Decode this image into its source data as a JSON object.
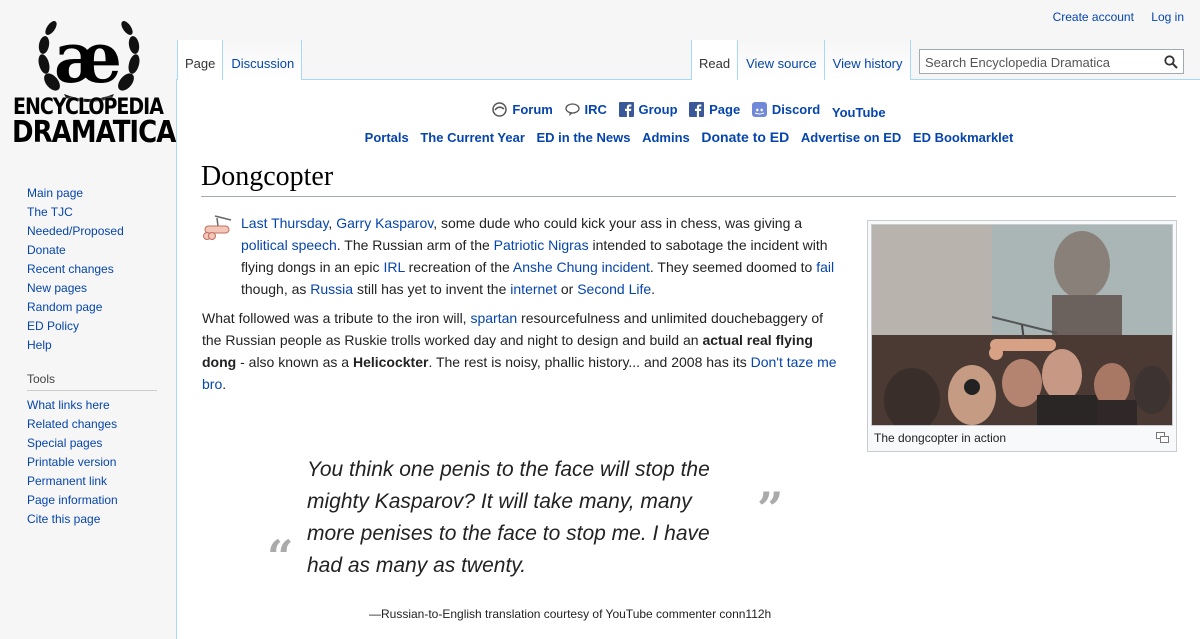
{
  "logo": {
    "mark": "æ",
    "line1": "ENCYCLOPEDIA",
    "line2": "DRAMATICA"
  },
  "personal": {
    "create_account": "Create account",
    "log_in": "Log in"
  },
  "tabs": {
    "left": [
      {
        "label": "Page",
        "selected": true
      },
      {
        "label": "Discussion",
        "selected": false
      }
    ],
    "right": [
      {
        "label": "Read",
        "selected": true
      },
      {
        "label": "View source",
        "selected": false
      },
      {
        "label": "View history",
        "selected": false
      }
    ]
  },
  "search": {
    "placeholder": "Search Encyclopedia Dramatica",
    "icon": "search-icon"
  },
  "sidebar": {
    "nav": [
      "Main page",
      "The TJC",
      "Needed/Proposed",
      "Donate",
      "Recent changes",
      "New pages",
      "Random page",
      "ED Policy",
      "Help"
    ],
    "tools_heading": "Tools",
    "tools": [
      "What links here",
      "Related changes",
      "Special pages",
      "Printable version",
      "Permanent link",
      "Page information",
      "Cite this page"
    ]
  },
  "topnav": {
    "row1": [
      {
        "label": "Forum",
        "icon": "forum-icon"
      },
      {
        "label": "IRC",
        "icon": "irc-icon"
      },
      {
        "label": "Group",
        "icon": "facebook-icon"
      },
      {
        "label": "Page",
        "icon": "facebook-icon"
      },
      {
        "label": "Discord",
        "icon": "discord-icon"
      },
      {
        "label": "YouTube",
        "icon": ""
      }
    ],
    "row2": [
      "Portals",
      "The Current Year",
      "ED in the News",
      "Admins",
      "Donate to ED",
      "Advertise on ED",
      "ED Bookmarklet"
    ]
  },
  "article": {
    "title": "Dongcopter",
    "p1": {
      "link1": "Last Thursday",
      "t1": ", ",
      "link2": "Garry Kasparov",
      "t2": ", some dude who could kick your ass in chess, was giving a ",
      "link3": "political speech",
      "t3": ". The Russian arm of the ",
      "link4": "Patriotic Nigras",
      "t4": " intended to sabotage the incident with flying dongs in an epic ",
      "link5": "IRL",
      "t5": " recreation of the ",
      "link6": "Anshe Chung incident",
      "t6": ". They seemed doomed to ",
      "link7": "fail",
      "t7": " though, as ",
      "link8": "Russia",
      "t8": " still has yet to invent the ",
      "link9": "internet",
      "t9": " or ",
      "link10": "Second Life",
      "t10": "."
    },
    "p2": {
      "t1": "What followed was a tribute to the iron will, ",
      "link1": "spartan",
      "t2": " resourcefulness and unlimited douchebaggery of the Russian people as Ruskie trolls worked day and night to design and build an ",
      "b1": "actual real flying dong",
      "t3": " - also known as a ",
      "b2": "Helicockter",
      "t4": ". The rest is noisy, phallic history... and 2008 has its ",
      "link2": "Don't taze me bro",
      "t5": "."
    },
    "thumb_caption": "The dongcopter in action",
    "quote": "You think one penis to the face will stop the mighty Kasparov? It will take many, many more penises to the face to stop me. I have had as many as twenty.",
    "quote_open": "“",
    "quote_close": "”",
    "attribution": "—Russian-to-English translation courtesy of YouTube commenter conn112h"
  }
}
